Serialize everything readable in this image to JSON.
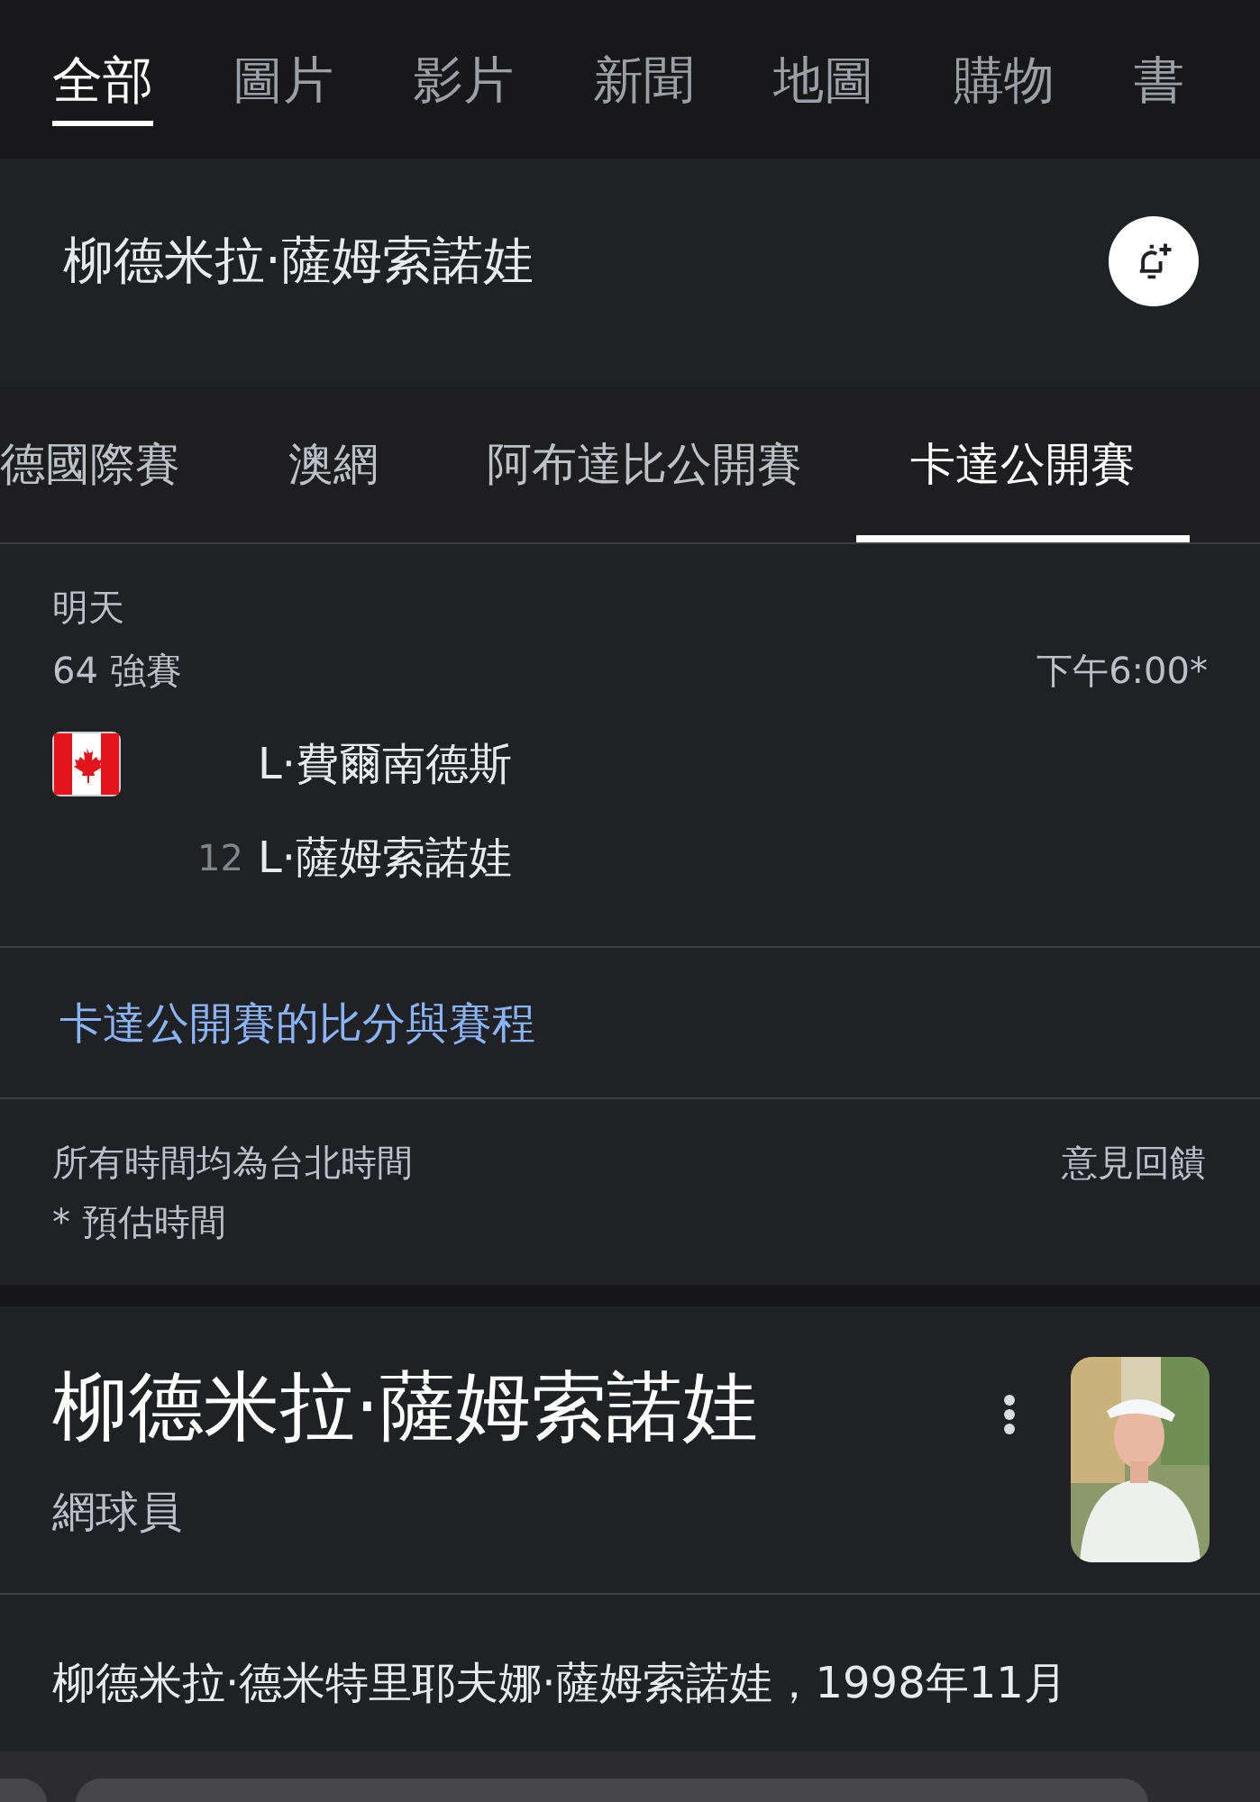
{
  "search_tabs": [
    {
      "label": "全部",
      "selected": true
    },
    {
      "label": "圖片",
      "selected": false
    },
    {
      "label": "影片",
      "selected": false
    },
    {
      "label": "新聞",
      "selected": false
    },
    {
      "label": "地圖",
      "selected": false
    },
    {
      "label": "購物",
      "selected": false
    },
    {
      "label": "書",
      "selected": false
    }
  ],
  "query_title": "柳德米拉·薩姆索諾娃",
  "tournament_tabs": [
    {
      "label": "德國際賽",
      "selected": false
    },
    {
      "label": "澳網",
      "selected": false
    },
    {
      "label": "阿布達比公開賽",
      "selected": false
    },
    {
      "label": "卡達公開賽",
      "selected": true
    }
  ],
  "match": {
    "day": "明天",
    "round": "64 強賽",
    "time": "下午6:00*",
    "players": [
      {
        "name": "L·費爾南德斯",
        "flag_shown": true
      },
      {
        "seed": "12",
        "name": "L·薩姆索諾娃",
        "flag_shown": false
      }
    ]
  },
  "schedule_link": "卡達公開賽的比分與賽程",
  "footer": {
    "timezone_note": "所有時間均為台北時間",
    "estimate_note": "* 預估時間",
    "feedback": "意見回饋"
  },
  "entity": {
    "name": "柳德米拉·薩姆索諾娃",
    "subtitle": "網球員"
  },
  "description": "柳德米拉·德米特里耶夫娜·薩姆索諾娃，1998年11月"
}
